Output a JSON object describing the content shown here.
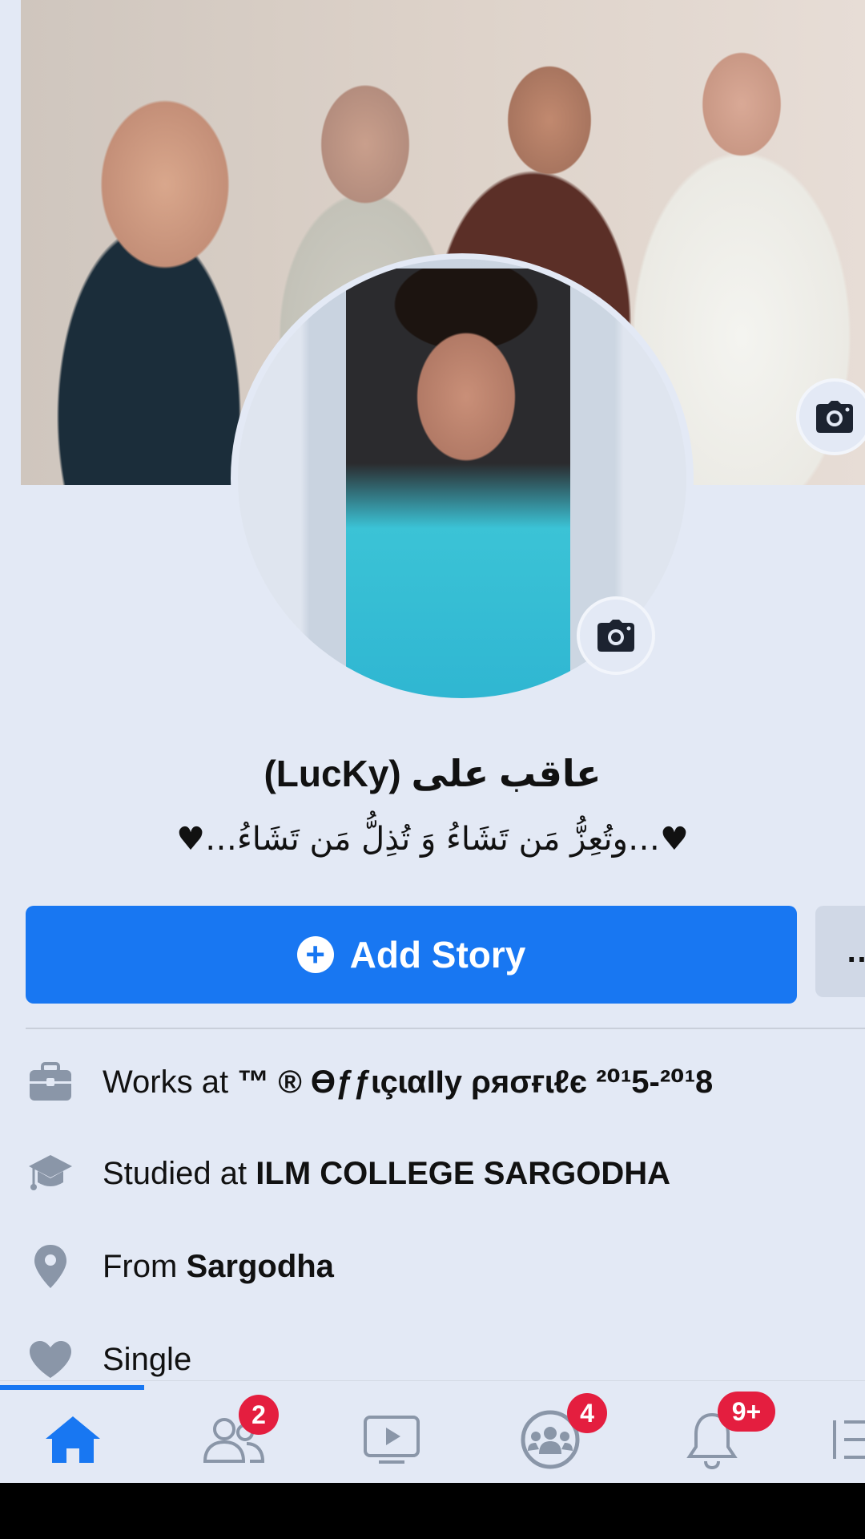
{
  "profile": {
    "name": "(LucKy) عاقب علی",
    "bio": "♥…وتُعِزُّ مَن تَشَاءُ وَ تُذِلُّ مَن تَشَاءُ…♥"
  },
  "actions": {
    "add_story_label": "Add Story",
    "more_label": "…"
  },
  "info": {
    "work_prefix": "Works at",
    "work_value": "™ ® ƟƒƒɩçɩαƖƖy ρяσғɩℓє ²⁰¹5-²⁰¹8",
    "study_prefix": "Studied at",
    "study_value": "ILM COLLEGE SARGODHA",
    "from_prefix": "From",
    "from_value": "Sargodha",
    "relationship": "Single"
  },
  "tabbar": {
    "friends_badge": "2",
    "groups_badge": "4",
    "notifications_badge": "9+"
  },
  "colors": {
    "accent": "#1877f2",
    "badge": "#e41e3f",
    "icon_gray": "#8a96a8",
    "background": "#e3e9f5"
  },
  "icons": {
    "cover_camera": "camera-icon",
    "avatar_camera": "camera-icon",
    "work": "briefcase-icon",
    "study": "graduation-cap-icon",
    "location": "location-pin-icon",
    "relationship": "heart-icon",
    "home": "home-icon",
    "friends": "friends-icon",
    "watch": "video-icon",
    "groups": "groups-icon",
    "notifications": "bell-icon",
    "menu": "menu-icon"
  }
}
